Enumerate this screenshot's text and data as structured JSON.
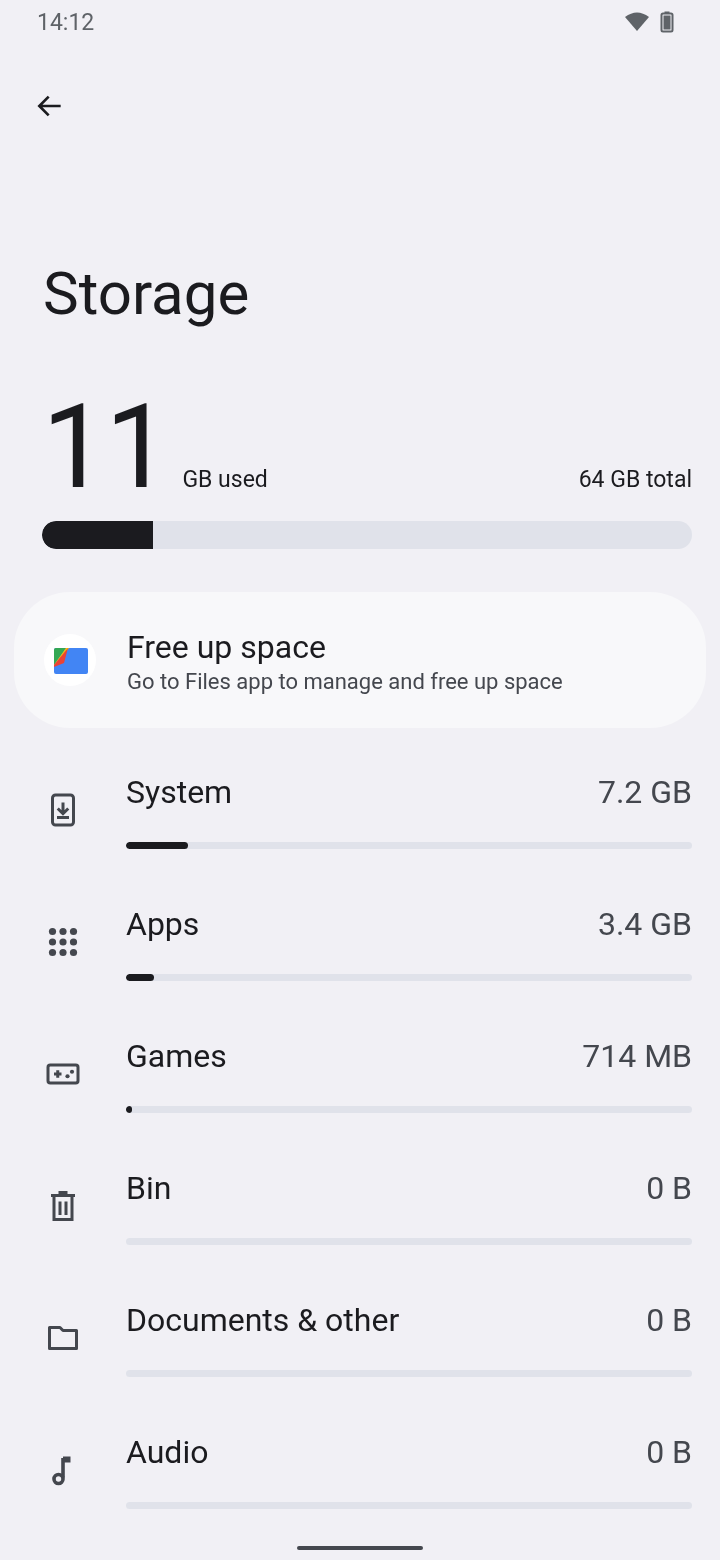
{
  "status_bar": {
    "time": "14:12"
  },
  "title": "Storage",
  "usage": {
    "amount": "11",
    "unit": "GB used",
    "total": "64 GB total",
    "level": 0.17
  },
  "free_up_card": {
    "title": "Free up space",
    "subtitle": "Go to Files app to manage and free up space"
  },
  "categories": [
    {
      "kind": "system",
      "name": "System",
      "size": "7.2 GB",
      "level": 0.11
    },
    {
      "kind": "apps",
      "name": "Apps",
      "size": "3.4 GB",
      "level": 0.05
    },
    {
      "kind": "games",
      "name": "Games",
      "size": "714 MB",
      "level": 0.01
    },
    {
      "kind": "bin",
      "name": "Bin",
      "size": "0 B",
      "level": 0
    },
    {
      "kind": "documents",
      "name": "Documents & other",
      "size": "0 B",
      "level": 0
    },
    {
      "kind": "audio",
      "name": "Audio",
      "size": "0 B",
      "level": 0
    }
  ]
}
